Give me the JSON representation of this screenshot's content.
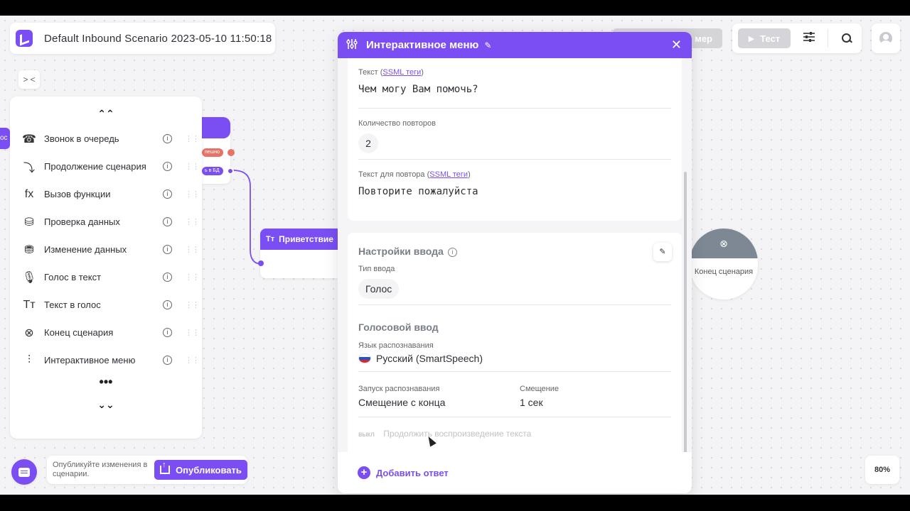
{
  "header": {
    "scenario_title": "Default Inbound Scenario 2023-05-10 11:50:18",
    "collapse_icon": "> <"
  },
  "palette": {
    "items": [
      {
        "label": "Звонок в очередь",
        "icon": "queue-call-icon",
        "glyph": "☎"
      },
      {
        "label": "Продолжение сценария",
        "icon": "continue-scenario-icon",
        "glyph": "⤵"
      },
      {
        "label": "Вызов функции",
        "icon": "function-icon",
        "glyph": "fx"
      },
      {
        "label": "Проверка данных",
        "icon": "data-check-icon",
        "glyph": "⛁"
      },
      {
        "label": "Изменение данных",
        "icon": "data-edit-icon",
        "glyph": "⛃"
      },
      {
        "label": "Голос в текст",
        "icon": "voice-to-text-icon",
        "glyph": "🎙"
      },
      {
        "label": "Текст в голос",
        "icon": "text-to-voice-icon",
        "glyph": "Tт"
      },
      {
        "label": "Конец сценария",
        "icon": "end-scenario-icon",
        "glyph": "⊗"
      },
      {
        "label": "Интерактивное меню",
        "icon": "interactive-menu-icon",
        "glyph": "⫶"
      }
    ],
    "info_glyph": "i",
    "more_glyph": "•••",
    "up_glyph": "⌃⌃",
    "down_glyph": "⌄⌄"
  },
  "canvas": {
    "left_node_fragment": "ос",
    "pill_error": "пешно",
    "pill_save": "ь в БД",
    "greeting_title": "Приветствие",
    "end_node_label": "Конец сценария"
  },
  "toolbar": {
    "example_label": "мер",
    "test_label": "Тест",
    "play_glyph": "▶",
    "settings_glyph": "⚙"
  },
  "panel": {
    "title": "Интерактивное меню",
    "text_label": "Текст (",
    "ssml_link": "SSML теги",
    "text_label_close": ")",
    "text_value": "Чем могу Вам помочь?",
    "repeat_count_label": "Количество повторов",
    "repeat_count_value": "2",
    "repeat_text_label": "Текст для повтора (",
    "repeat_text_value": "Повторите пожалуйста",
    "input_settings_title": "Настройки ввода",
    "input_type_label": "Тип ввода",
    "input_type_value": "Голос",
    "voice_input_title": "Голосовой ввод",
    "recognition_lang_label": "Язык распознавания",
    "recognition_lang_value": "Русский (SmartSpeech)",
    "recognition_start_label": "Запуск распознавания",
    "recognition_start_value": "Смещение с конца",
    "offset_label": "Смещение",
    "offset_value": "1 сек",
    "toggle_state": "выкл",
    "toggle_label": "Продолжить воспроизведение текста",
    "add_answer_label": "Добавить ответ",
    "close_glyph": "✕",
    "edit_glyph": "✎"
  },
  "bottom": {
    "publish_hint": "Опубликуйте изменения в сценарии.",
    "publish_label": "Опубликовать",
    "zoom": "80%"
  },
  "colors": {
    "accent": "#7a4ef2",
    "error_port": "#e67466",
    "end_node": "#7d8894"
  }
}
